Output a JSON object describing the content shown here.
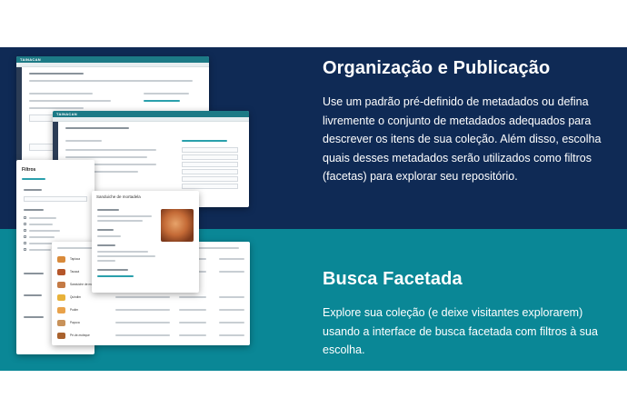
{
  "section1": {
    "title": "Organização e Publicação",
    "body": "Use um padrão pré-definido de metadados ou defina livremente o conjunto de metadados adequados para descrever os itens de sua coleção. Além disso, escolha quais desses metadados serão utilizados como filtros (facetas) para explorar seu repositório."
  },
  "section2": {
    "title": "Busca Facetada",
    "body": "Explore sua coleção (e deixe visitantes explorarem) usando a interface de busca facetada com filtros à sua escolha."
  },
  "mock": {
    "app_name": "TAINACAN",
    "filters_title": "Filtros",
    "modal_title": "Sanduiche de mortadela",
    "items": [
      "Tapioca",
      "Tacacá",
      "Sanduiche de mortadela",
      "Quindim",
      "Pudim",
      "Paçoca",
      "Pé-de-moleque"
    ]
  },
  "colors": {
    "navy": "#0f2a55",
    "teal": "#0a8796",
    "app_teal": "#1c7a86"
  }
}
